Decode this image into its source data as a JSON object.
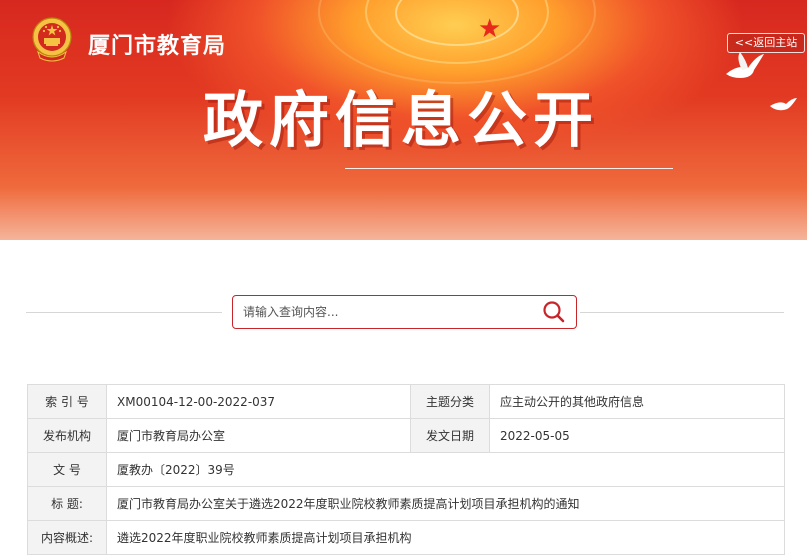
{
  "header": {
    "site_title": "厦门市教育局",
    "back_home_label": "<<返回主站",
    "hero_title": "政府信息公开",
    "accent_color": "#c8252a",
    "banner_color": "#e02a1f",
    "icons": [
      "emblem-icon",
      "dove-icon",
      "star-icon"
    ]
  },
  "search": {
    "placeholder": "请输入查询内容...",
    "button_icon": "search-icon"
  },
  "info_table": {
    "index_label": "索 引 号",
    "index_value": "XM00104-12-00-2022-037",
    "topic_label": "主题分类",
    "topic_value": "应主动公开的其他政府信息",
    "publisher_label": "发布机构",
    "publisher_value": "厦门市教育局办公室",
    "date_label": "发文日期",
    "date_value": "2022-05-05",
    "docno_label": "文  号",
    "docno_value": "厦教办〔2022〕39号",
    "title_label": "标 题:",
    "title_value": "厦门市教育局办公室关于遴选2022年度职业院校教师素质提高计划项目承担机构的通知",
    "summary_label": "内容概述:",
    "summary_value": "遴选2022年度职业院校教师素质提高计划项目承担机构"
  }
}
